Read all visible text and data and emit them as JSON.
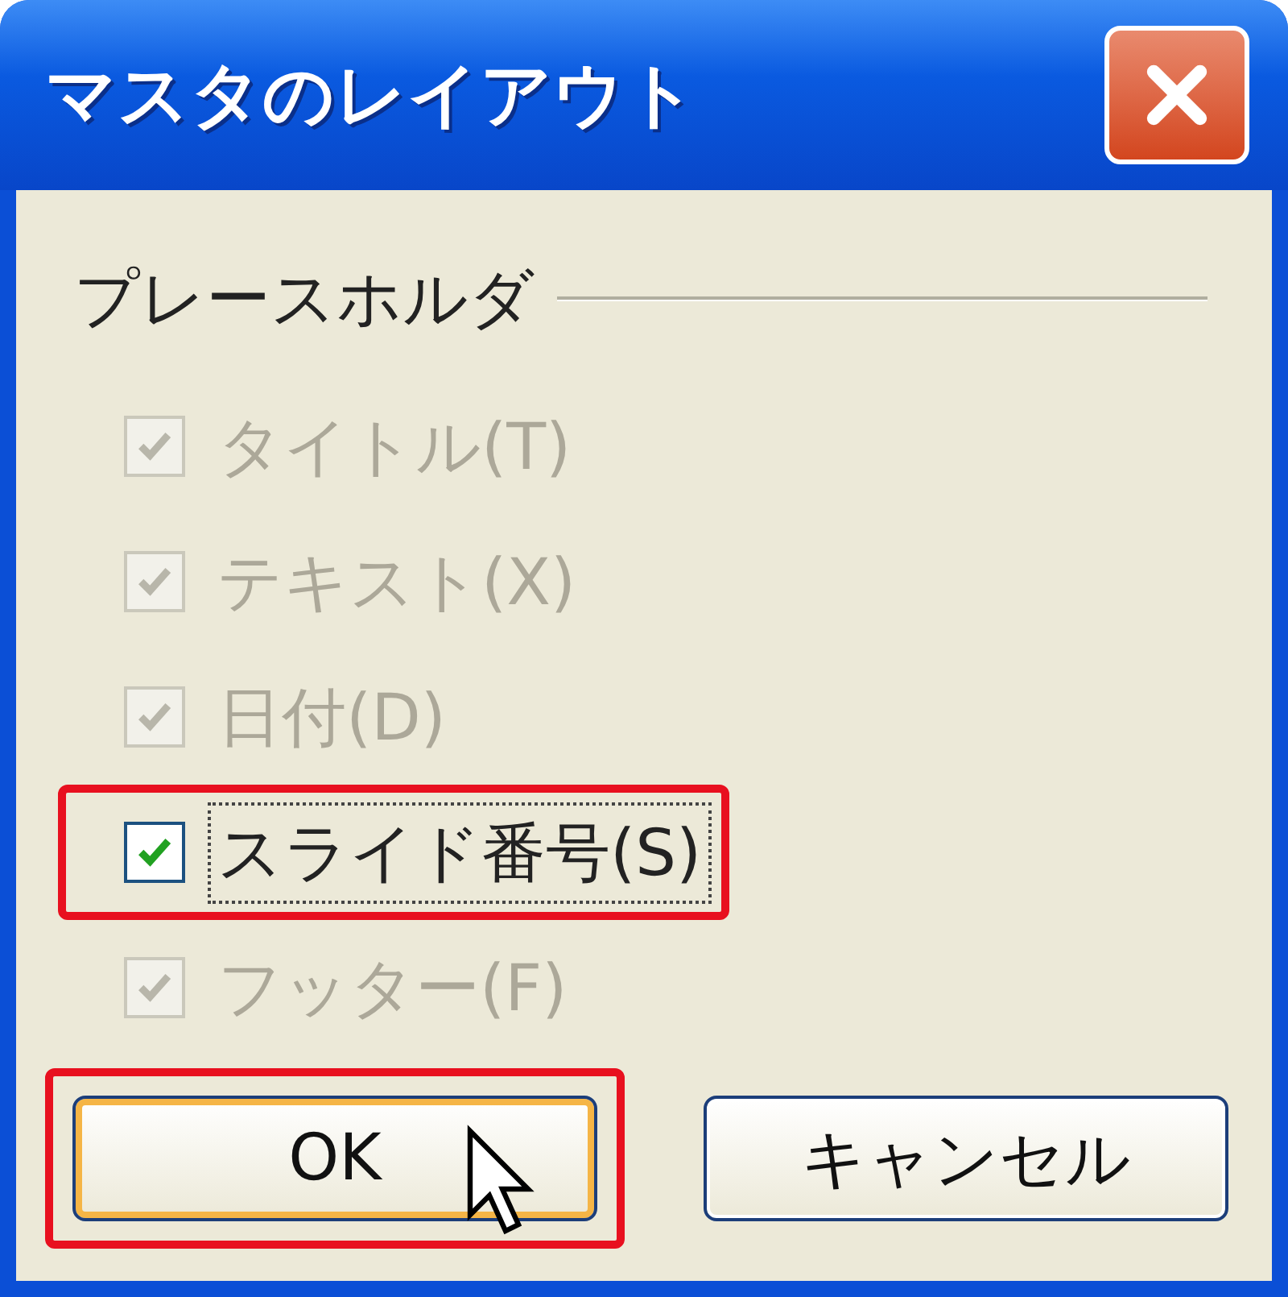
{
  "window": {
    "title": "マスタのレイアウト"
  },
  "group": {
    "label": "プレースホルダ"
  },
  "checkboxes": [
    {
      "label": "タイトル(T)",
      "checked": true,
      "disabled": true,
      "focused": false,
      "highlighted": false
    },
    {
      "label": "テキスト(X)",
      "checked": true,
      "disabled": true,
      "focused": false,
      "highlighted": false
    },
    {
      "label": "日付(D)",
      "checked": true,
      "disabled": true,
      "focused": false,
      "highlighted": false
    },
    {
      "label": "スライド番号(S)",
      "checked": true,
      "disabled": false,
      "focused": true,
      "highlighted": true
    },
    {
      "label": "フッター(F)",
      "checked": true,
      "disabled": true,
      "focused": false,
      "highlighted": false
    }
  ],
  "buttons": [
    {
      "label": "OK",
      "default": true,
      "highlighted": true
    },
    {
      "label": "キャンセル",
      "default": false,
      "highlighted": false
    }
  ]
}
